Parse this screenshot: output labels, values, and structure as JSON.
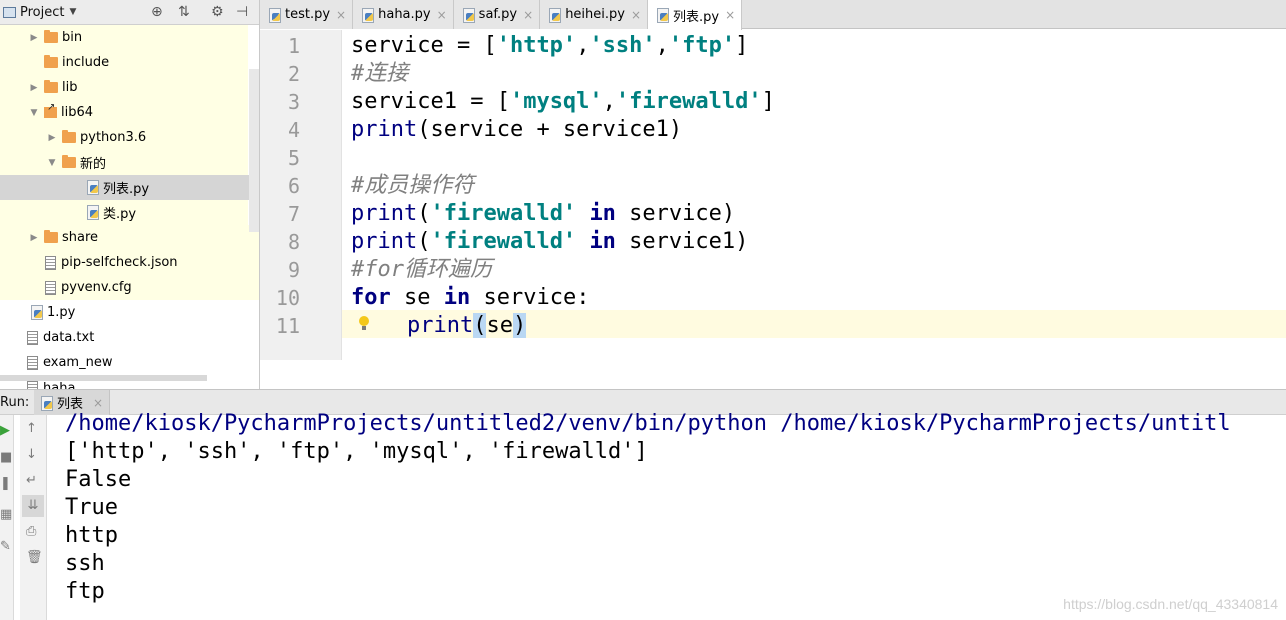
{
  "project_panel": {
    "title": "Project",
    "tree": [
      {
        "label": "bin",
        "type": "folder",
        "arrow": "▶"
      },
      {
        "label": "include",
        "type": "folder",
        "arrow": ""
      },
      {
        "label": "lib",
        "type": "folder",
        "arrow": "▶"
      },
      {
        "label": "lib64",
        "type": "folder-link",
        "arrow": "▼"
      },
      {
        "label": "python3.6",
        "type": "folder",
        "arrow": "▶"
      },
      {
        "label": "新的",
        "type": "folder",
        "arrow": "▼"
      },
      {
        "label": "列表.py",
        "type": "python",
        "arrow": ""
      },
      {
        "label": "类.py",
        "type": "python",
        "arrow": ""
      },
      {
        "label": "share",
        "type": "folder",
        "arrow": "▶"
      },
      {
        "label": "pip-selfcheck.json",
        "type": "file",
        "arrow": ""
      },
      {
        "label": "pyvenv.cfg",
        "type": "file",
        "arrow": ""
      },
      {
        "label": "1.py",
        "type": "python",
        "arrow": ""
      },
      {
        "label": "data.txt",
        "type": "file",
        "arrow": ""
      },
      {
        "label": "exam_new",
        "type": "file",
        "arrow": ""
      },
      {
        "label": "haha",
        "type": "file",
        "arrow": ""
      }
    ]
  },
  "editor": {
    "tabs": [
      {
        "label": "test.py",
        "active": false
      },
      {
        "label": "haha.py",
        "active": false
      },
      {
        "label": "saf.py",
        "active": false
      },
      {
        "label": "heihei.py",
        "active": false
      },
      {
        "label": "列表.py",
        "active": true
      }
    ],
    "line_numbers": [
      "1",
      "2",
      "3",
      "4",
      "5",
      "6",
      "7",
      "8",
      "9",
      "10",
      "11"
    ],
    "code": {
      "l1_a": "service = [",
      "l1_s1": "'http'",
      "l1_c1": ",",
      "l1_s2": "'ssh'",
      "l1_c2": ",",
      "l1_s3": "'ftp'",
      "l1_b": "]",
      "l2_cm": "#连接",
      "l3_a": "service1 = [",
      "l3_s1": "'mysql'",
      "l3_c1": ",",
      "l3_s2": "'firewalld'",
      "l3_b": "]",
      "l4_fn": "print",
      "l4_a": "(service + service1)",
      "l6_cm": "#成员操作符",
      "l7_fn": "print",
      "l7_p": "(",
      "l7_s": "'firewalld'",
      "l7_kw": "in",
      "l7_b": " service)",
      "l8_fn": "print",
      "l8_p": "(",
      "l8_s": "'firewalld'",
      "l8_kw": "in",
      "l8_b": " service1)",
      "l9_cm": "#for循环遍历",
      "l10_kw1": "for",
      "l10_a": " se ",
      "l10_kw2": "in",
      "l10_b": " service:",
      "l11_fn": "print",
      "l11_p1": "(",
      "l11_a": "se",
      "l11_p2": ")"
    }
  },
  "run": {
    "label": "Run:",
    "tab_label": "列表",
    "output": [
      "/home/kiosk/PycharmProjects/untitled2/venv/bin/python /home/kiosk/PycharmProjects/untitl",
      "['http', 'ssh', 'ftp', 'mysql', 'firewalld']",
      "False",
      "True",
      "http",
      "ssh",
      "ftp"
    ]
  },
  "watermark": "https://blog.csdn.net/qq_43340814",
  "colors": {
    "keyword": "#000080",
    "string": "#008080",
    "comment": "#808080",
    "selected_row": "#d5d5d5",
    "excluded_bg": "#ffffe4"
  }
}
